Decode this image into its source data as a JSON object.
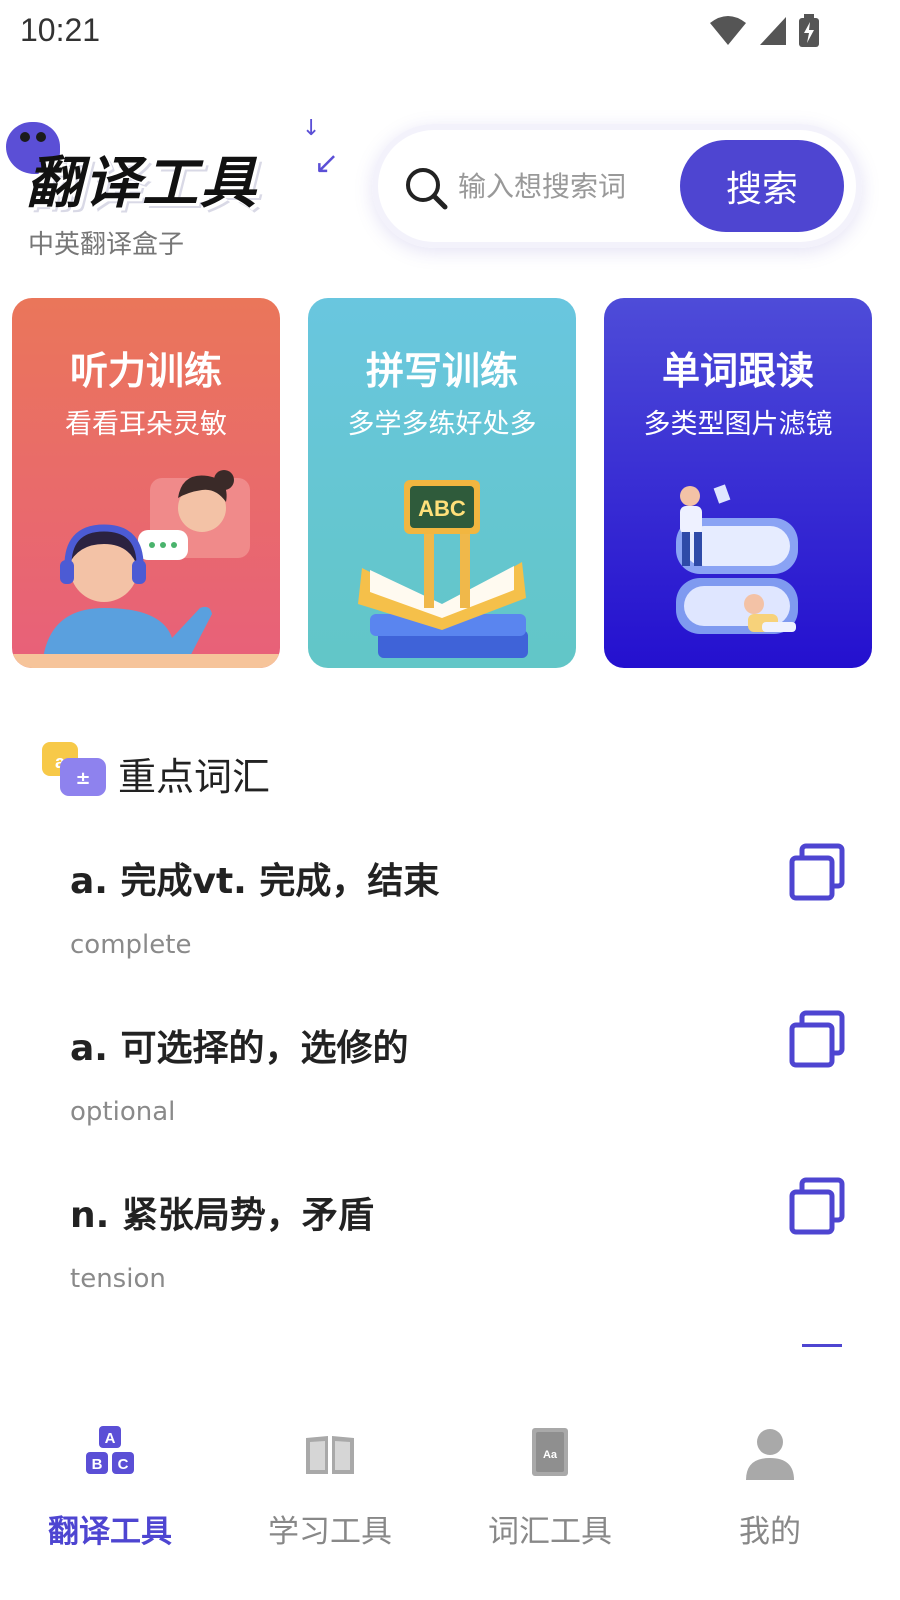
{
  "status_bar": {
    "time": "10:21"
  },
  "header": {
    "app_title": "翻译工具",
    "subtitle": "中英翻译盒子",
    "search": {
      "placeholder": "输入想搜索词",
      "button_label": "搜索"
    }
  },
  "cards": [
    {
      "title": "听力训练",
      "subtitle": "看看耳朵灵敏"
    },
    {
      "title": "拼写训练",
      "subtitle": "多学多练好处多",
      "board_text": "ABC"
    },
    {
      "title": "单词跟读",
      "subtitle": "多类型图片滤镜"
    }
  ],
  "vocab": {
    "section_title": "重点词汇",
    "items": [
      {
        "meaning": "a. 完成vt. 完成，结束",
        "word": "complete"
      },
      {
        "meaning": "a. 可选择的，选修的",
        "word": "optional"
      },
      {
        "meaning": "n. 紧张局势，矛盾",
        "word": "tension"
      }
    ]
  },
  "bottom_nav": {
    "active": 0,
    "items": [
      {
        "label": "翻译工具",
        "icon": "abc-blocks-icon",
        "badge": "ABC"
      },
      {
        "label": "学习工具",
        "icon": "open-book-icon"
      },
      {
        "label": "词汇工具",
        "icon": "dictionary-icon",
        "badge": "Aa"
      },
      {
        "label": "我的",
        "icon": "user-icon"
      }
    ]
  },
  "colors": {
    "accent": "#4e45d1",
    "card_listening": "#e8697a",
    "card_spelling": "#66c6d6",
    "card_reading": "#3a2ed6"
  }
}
